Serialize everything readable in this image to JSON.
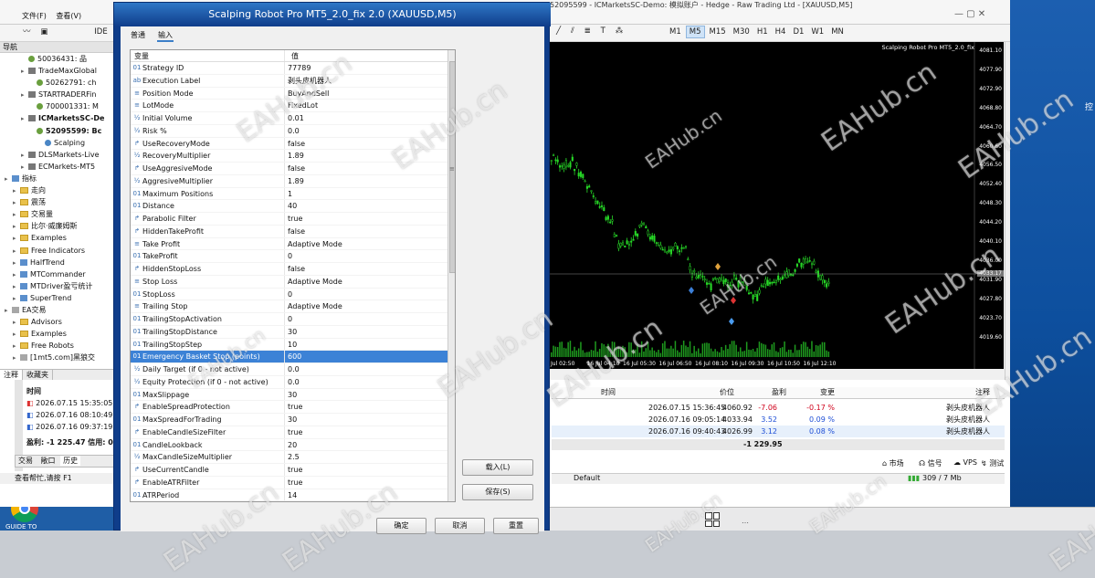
{
  "terminal": {
    "title_fragment": "52095599 - ICMarketsSC-Demo: 模拟账户 - Hedge - Raw Trading Ltd - [XAUUSD,M5]",
    "menu": [
      "文件(F)",
      "查看(V)"
    ],
    "timeframes": [
      "M1",
      "M5",
      "M15",
      "M30",
      "H1",
      "H4",
      "D1",
      "W1",
      "MN"
    ],
    "active_timeframe": "M5",
    "toolbar_ide": "IDE",
    "notification_count": "1"
  },
  "navigator": {
    "header": "导航",
    "items": [
      "50036431: 品",
      "TradeMaxGlobal",
      "50262791: ch",
      "STARTRADERFin",
      "700001331: M",
      "ICMarketsSC-De",
      "52095599: Bc",
      "Scalping",
      "DLSMarkets-Live",
      "ECMarkets-MT5",
      "指标",
      "走向",
      "震荡",
      "交易量",
      "比尔·威廉姆斯",
      "Examples",
      "Free Indicators",
      "HalfTrend",
      "MTCommander",
      "MTDriver盈亏统计",
      "SuperTrend",
      "EA交易",
      "Advisors",
      "Examples",
      "Free Robots",
      "[1mt5.com]黑狼交"
    ],
    "tabs": [
      "注释",
      "收藏夹"
    ]
  },
  "left_log": {
    "header": "时间",
    "rows": [
      "2026.07.15 15:35:05",
      "2026.07.16 08:10:49",
      "2026.07.16 09:37:19"
    ],
    "balance": "盈利: -1 225.47  信用: 0",
    "tabs": [
      "交易",
      "敞口",
      "历史"
    ],
    "status": "查看帮忙,请按 F1"
  },
  "chart": {
    "title": "Scalping Robot Pro MT5_2.0_fix",
    "price_labels": [
      "4081.10",
      "4077.90",
      "4072.90",
      "4068.80",
      "4064.70",
      "4060.60",
      "4056.50",
      "4052.40",
      "4048.30",
      "4044.20",
      "4040.10",
      "4036.00",
      "4031.90",
      "4027.80",
      "4023.70",
      "4019.60"
    ],
    "current_price": "4033.17",
    "time_labels": [
      "Jul 02:50",
      "16 Jul 04:10",
      "16 Jul 05:30",
      "16 Jul 06:50",
      "16 Jul 08:10",
      "16 Jul 09:30",
      "16 Jul 10:50",
      "16 Jul 12:10"
    ]
  },
  "trades": {
    "headers": [
      "时间",
      "价位",
      "盈利",
      "变更",
      "注释"
    ],
    "rows": [
      {
        "time": "2026.07.15 15:36:45",
        "price": "4060.92",
        "profit": "-7.06",
        "change": "-0.17 %",
        "comment": "剥头皮机器人"
      },
      {
        "time": "2026.07.16 09:05:14",
        "price": "4033.94",
        "profit": "3.52",
        "change": "0.09 %",
        "comment": "剥头皮机器人"
      },
      {
        "time": "2026.07.16 09:40:43",
        "price": "4026.99",
        "profit": "3.12",
        "change": "0.08 %",
        "comment": "剥头皮机器人"
      }
    ],
    "total": "-1 229.95",
    "tabs": [
      "市场",
      "信号",
      "VPS",
      "测试"
    ],
    "status_default": "Default",
    "status_traffic": "309 / 7 Mb",
    "loss_color": "#d0021b",
    "gain_color": "#1f4fd6"
  },
  "dialog": {
    "title": "Scalping Robot Pro MT5_2.0_fix 2.0 (XAUUSD,M5)",
    "tabs": [
      "普通",
      "输入"
    ],
    "active_tab": "输入",
    "col_var": "变量",
    "col_val": "值",
    "highlight_color": "#3c82d6",
    "params": [
      {
        "icon": "01",
        "name": "Strategy ID",
        "value": "77789"
      },
      {
        "icon": "ab",
        "name": "Execution Label",
        "value": "剥头皮机器人"
      },
      {
        "icon": "≡",
        "name": "Position Mode",
        "value": "BuyAndSell"
      },
      {
        "icon": "≡",
        "name": "LotMode",
        "value": "FixedLot"
      },
      {
        "icon": "½",
        "name": "Initial Volume",
        "value": "0.01"
      },
      {
        "icon": "½",
        "name": "Risk %",
        "value": "0.0"
      },
      {
        "icon": "↱",
        "name": "UseRecoveryMode",
        "value": "false"
      },
      {
        "icon": "½",
        "name": "RecoveryMultiplier",
        "value": "1.89"
      },
      {
        "icon": "↱",
        "name": "UseAggresiveMode",
        "value": "false"
      },
      {
        "icon": "½",
        "name": "AggresiveMultiplier",
        "value": "1.89"
      },
      {
        "icon": "01",
        "name": "Maximum Positions",
        "value": "1"
      },
      {
        "icon": "01",
        "name": "Distance",
        "value": "40"
      },
      {
        "icon": "↱",
        "name": "Parabolic Filter",
        "value": "true"
      },
      {
        "icon": "↱",
        "name": "HiddenTakeProfit",
        "value": "false"
      },
      {
        "icon": "≡",
        "name": "Take Profit",
        "value": "Adaptive Mode"
      },
      {
        "icon": "01",
        "name": "TakeProfit",
        "value": "0"
      },
      {
        "icon": "↱",
        "name": "HiddenStopLoss",
        "value": "false"
      },
      {
        "icon": "≡",
        "name": "Stop Loss",
        "value": "Adaptive Mode"
      },
      {
        "icon": "01",
        "name": "StopLoss",
        "value": "0"
      },
      {
        "icon": "≡",
        "name": "Trailing Stop",
        "value": "Adaptive Mode"
      },
      {
        "icon": "01",
        "name": "TrailingStopActivation",
        "value": "0"
      },
      {
        "icon": "01",
        "name": "TrailingStopDistance",
        "value": "30"
      },
      {
        "icon": "01",
        "name": "TrailingStopStep",
        "value": "10"
      },
      {
        "icon": "01",
        "name": "Emergency Basket Stop (points)",
        "value": "600"
      },
      {
        "icon": "½",
        "name": "Daily Target (if 0 - not active)",
        "value": "0.0"
      },
      {
        "icon": "½",
        "name": "Equity Protection (if 0 - not active)",
        "value": "0.0"
      },
      {
        "icon": "01",
        "name": "MaxSlippage",
        "value": "30"
      },
      {
        "icon": "↱",
        "name": "EnableSpreadProtection",
        "value": "true"
      },
      {
        "icon": "01",
        "name": "MaxSpreadForTrading",
        "value": "30"
      },
      {
        "icon": "↱",
        "name": "EnableCandleSizeFilter",
        "value": "true"
      },
      {
        "icon": "01",
        "name": "CandleLookback",
        "value": "20"
      },
      {
        "icon": "½",
        "name": "MaxCandleSizeMultiplier",
        "value": "2.5"
      },
      {
        "icon": "↱",
        "name": "UseCurrentCandle",
        "value": "true"
      },
      {
        "icon": "↱",
        "name": "EnableATRFilter",
        "value": "true"
      },
      {
        "icon": "01",
        "name": "ATRPeriod",
        "value": "14"
      }
    ],
    "load_button": "载入(L)",
    "save_button": "保存(S)",
    "ok_button": "确定",
    "cancel_button": "取消",
    "reset_button": "重置"
  },
  "desktop": {
    "chrome_label": "GUIDE TO",
    "side_label": "控"
  },
  "watermark": "EAHub.cn"
}
